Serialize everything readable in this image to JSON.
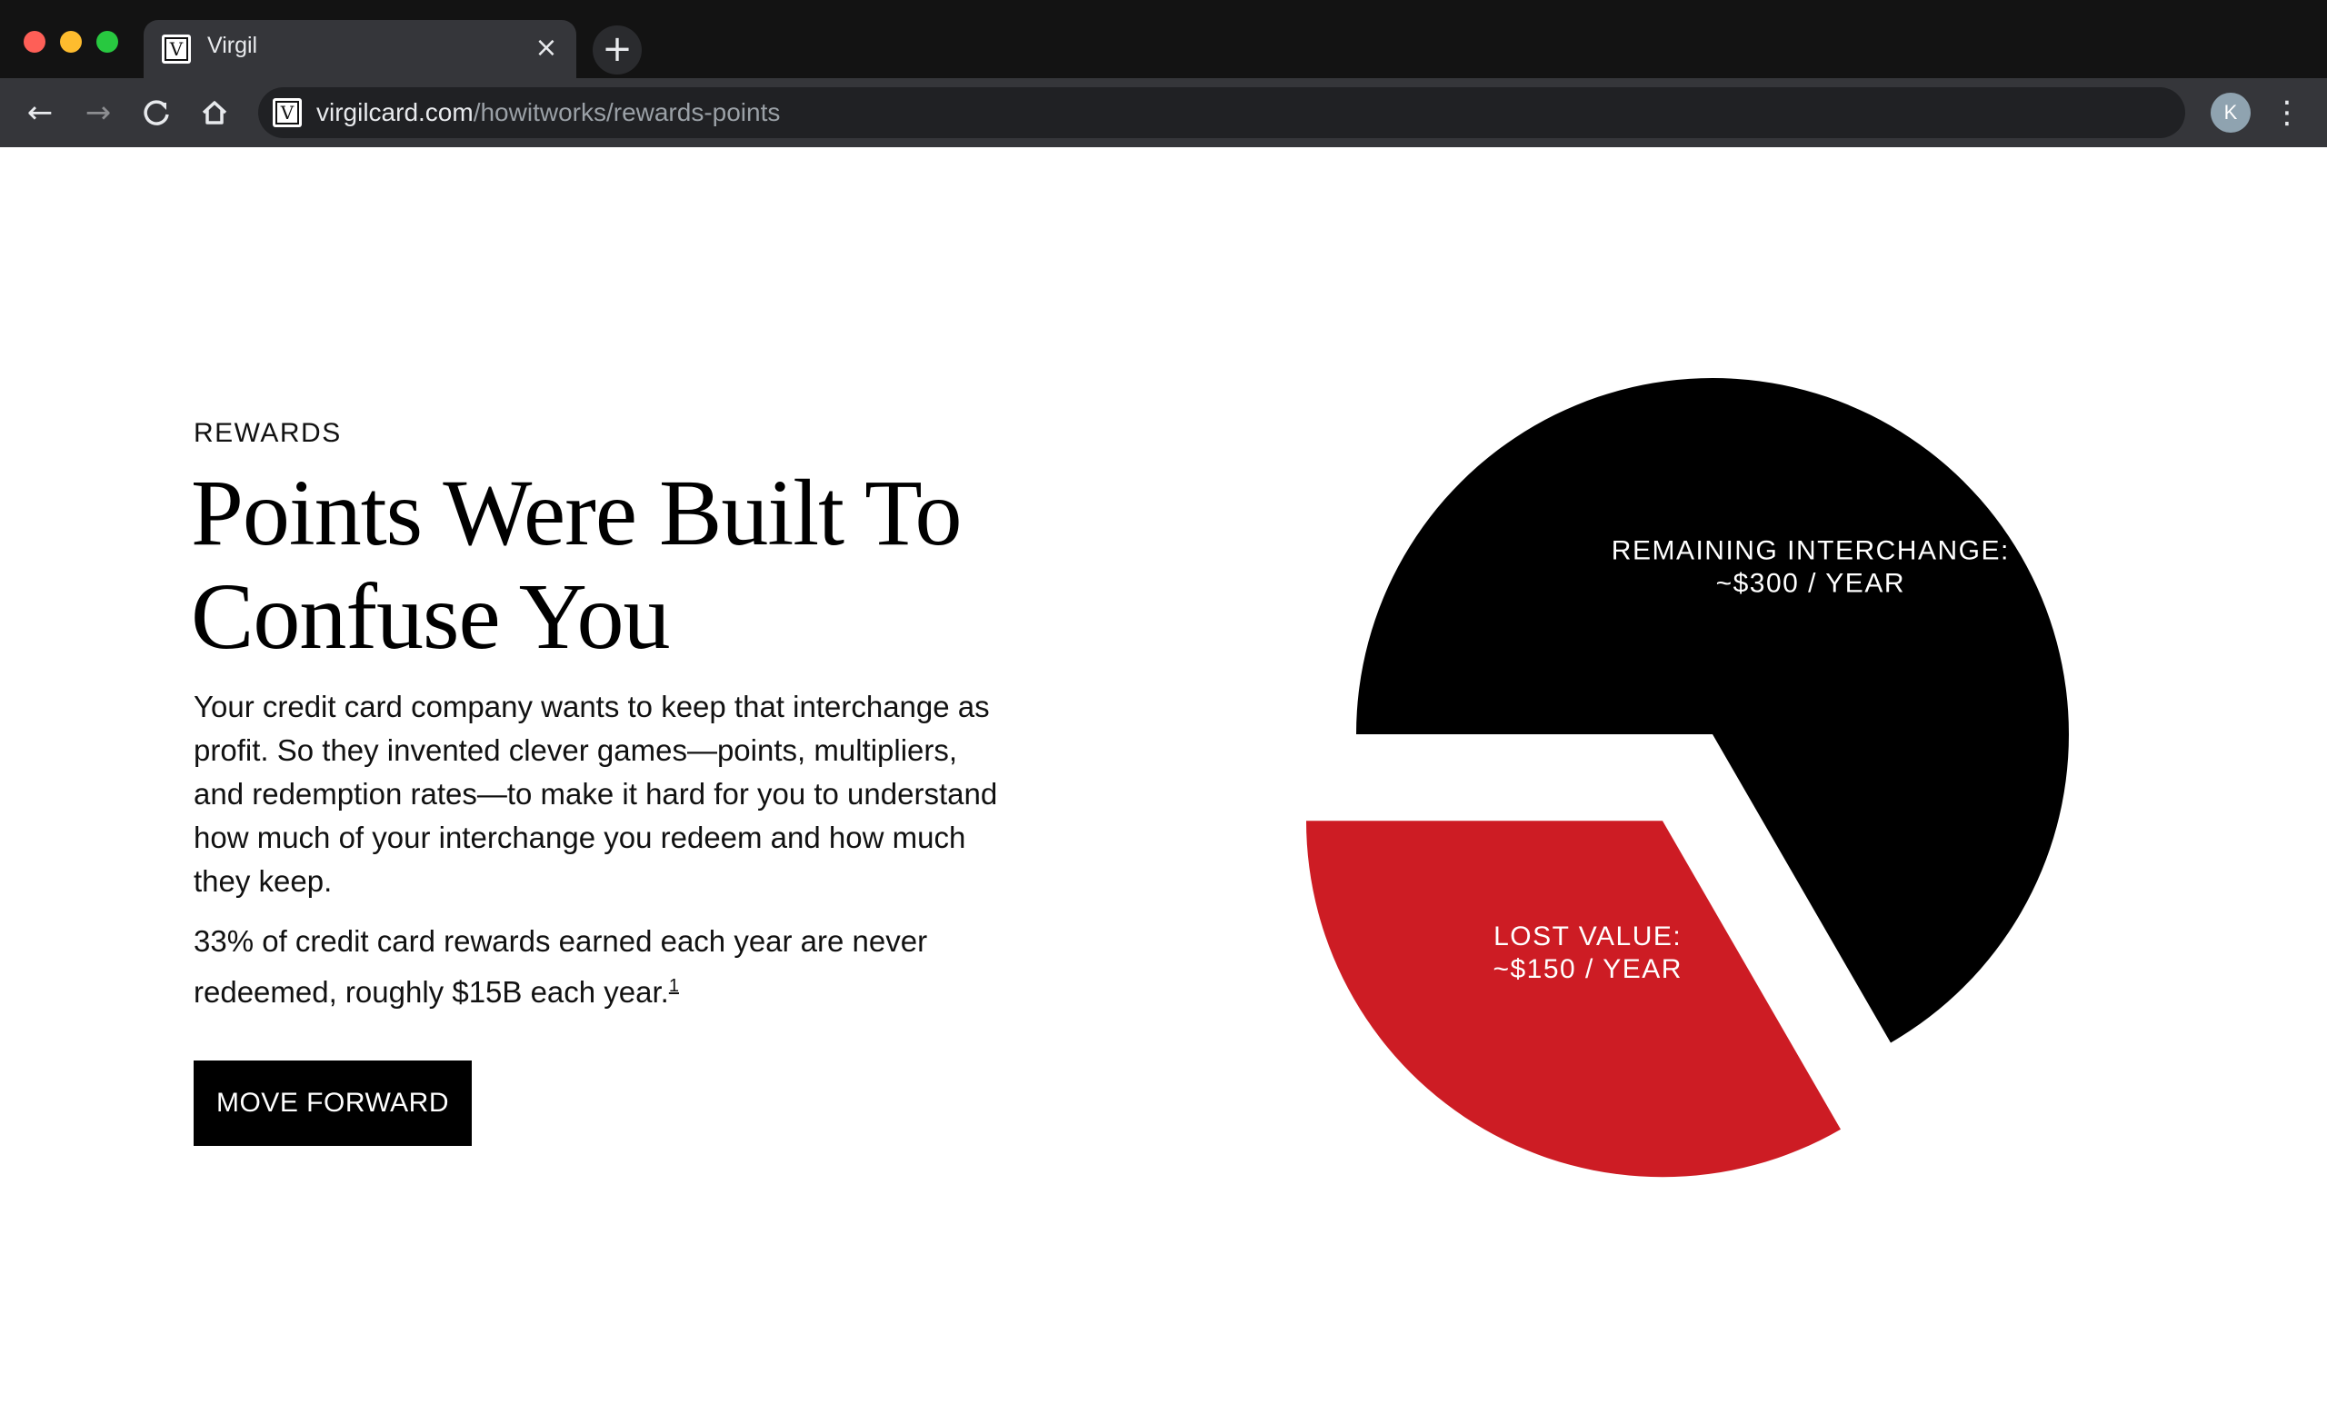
{
  "browser": {
    "tab_title": "Virgil",
    "tab_favicon_letter": "V",
    "tab_close_glyph": "×",
    "new_tab_glyph": "+",
    "url_host": "virgilcard.com",
    "url_path": "/howitworks/rewards-points",
    "profile_initial": "K",
    "icons": [
      "back-arrow-icon",
      "forward-arrow-icon",
      "reload-icon",
      "home-icon",
      "more-vertical-icon"
    ]
  },
  "content": {
    "eyebrow": "REWARDS",
    "headline_line1": "Points Were Built To",
    "headline_line2": "Confuse You",
    "body": "Your credit card company wants to keep that interchange as profit. So they invented clever games—points, multipliers, and redemption rates—to make it hard for you to understand how much of your interchange you redeem and how much they keep.",
    "stat": "33% of credit card rewards earned each year are never redeemed, roughly $15B each year.",
    "footnote": "1",
    "cta_label": "MOVE FORWARD"
  },
  "chart_data": {
    "type": "pie",
    "categories": [
      "REMAINING INTERCHANGE:",
      "LOST VALUE:"
    ],
    "values": [
      300,
      150
    ],
    "value_labels": [
      "~$300 / YEAR",
      "~$150 / YEAR"
    ],
    "colors": [
      "#000000",
      "#cd1c24"
    ],
    "exploded": [
      false,
      true
    ],
    "gap_color": "#ffffff"
  }
}
